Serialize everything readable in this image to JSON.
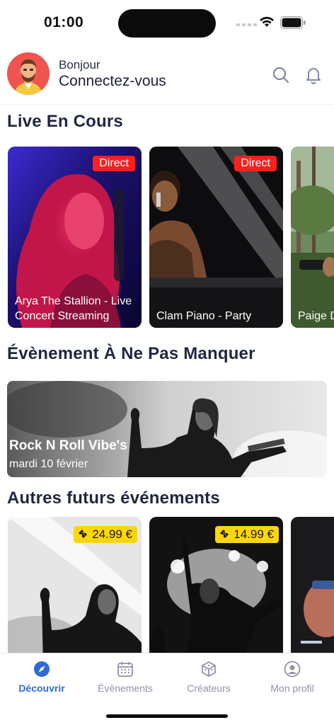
{
  "status_bar": {
    "time": "01:00"
  },
  "header": {
    "greeting": "Bonjour",
    "login_prompt": "Connectez-vous"
  },
  "sections": {
    "live": {
      "title": "Live En Cours",
      "cards": [
        {
          "badge": "Direct",
          "title": "Arya The Stallion - Live Concert Streaming"
        },
        {
          "badge": "Direct",
          "title": "Clam Piano - Party"
        },
        {
          "title": "Paige D Melbou"
        }
      ]
    },
    "featured": {
      "title": "Évènement À Ne Pas Manquer",
      "event": {
        "title": "Rock N Roll Vibe's",
        "date": "mardi 10 février"
      }
    },
    "upcoming": {
      "title": "Autres futurs événements",
      "cards": [
        {
          "price": "24.99 €"
        },
        {
          "price": "14.99 €"
        }
      ]
    }
  },
  "tab_bar": {
    "tabs": [
      {
        "label": "Découvrir",
        "icon": "compass-icon",
        "active": true
      },
      {
        "label": "Évènements",
        "icon": "calendar-icon",
        "active": false
      },
      {
        "label": "Créateurs",
        "icon": "cube-icon",
        "active": false
      },
      {
        "label": "Mon profil",
        "icon": "profile-icon",
        "active": false
      }
    ]
  },
  "colors": {
    "accent": "#2f6bd8",
    "live_badge": "#ff1f1f",
    "price_badge": "#ffd60a",
    "heading": "#1f2742",
    "tab_inactive": "#8e93a5"
  }
}
